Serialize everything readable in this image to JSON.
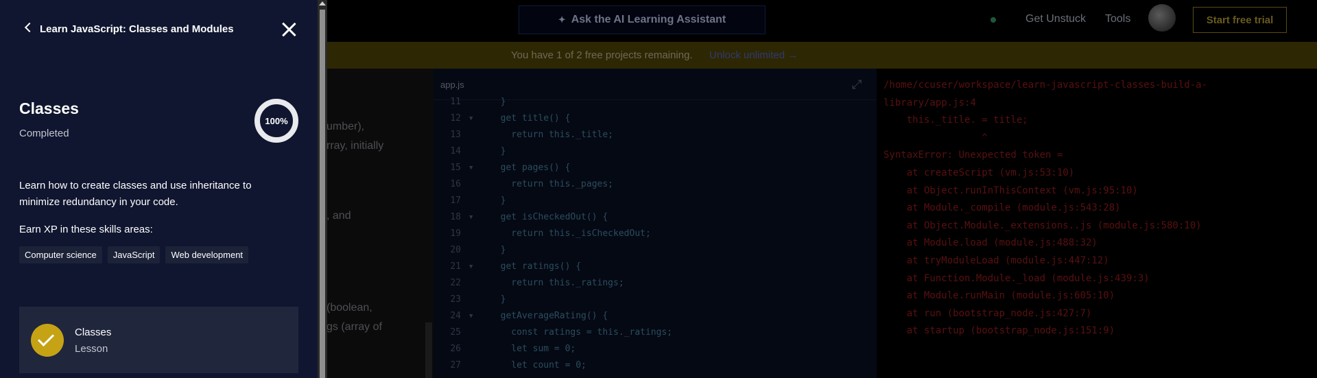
{
  "topbar": {
    "ai_button_label": "Ask the AI Learning Assistant",
    "ai_icon": "sparkle-icon",
    "get_unstuck": "Get Unstuck",
    "tools": "Tools",
    "start_trial": "Start free trial"
  },
  "banner": {
    "text": "You have 1 of 2 free projects remaining.",
    "link": "Unlock unlimited →"
  },
  "instructions": {
    "lines": [
      "umber),",
      "rray, initially",
      ", and",
      "(boolean,",
      "gs (array of"
    ]
  },
  "editor": {
    "file_tab": "app.js",
    "lines": [
      {
        "num": "11",
        "fold": "",
        "code": "  }"
      },
      {
        "num": "12",
        "fold": "▼",
        "code": "  get title() {"
      },
      {
        "num": "13",
        "fold": "",
        "code": "    return this._title;"
      },
      {
        "num": "14",
        "fold": "",
        "code": "  }"
      },
      {
        "num": "15",
        "fold": "▼",
        "code": "  get pages() {"
      },
      {
        "num": "16",
        "fold": "",
        "code": "    return this._pages;"
      },
      {
        "num": "17",
        "fold": "",
        "code": "  }"
      },
      {
        "num": "18",
        "fold": "▼",
        "code": "  get isCheckedOut() {"
      },
      {
        "num": "19",
        "fold": "",
        "code": "    return this._isCheckedOut;"
      },
      {
        "num": "20",
        "fold": "",
        "code": "  }"
      },
      {
        "num": "21",
        "fold": "▼",
        "code": "  get ratings() {"
      },
      {
        "num": "22",
        "fold": "",
        "code": "    return this._ratings;"
      },
      {
        "num": "23",
        "fold": "",
        "code": "  }"
      },
      {
        "num": "24",
        "fold": "▼",
        "code": "  getAverageRating() {"
      },
      {
        "num": "25",
        "fold": "",
        "code": "    const ratings = this._ratings;"
      },
      {
        "num": "26",
        "fold": "",
        "code": "    let sum = 0;"
      },
      {
        "num": "27",
        "fold": "",
        "code": "    let count = 0;"
      }
    ]
  },
  "terminal": {
    "lines": [
      "/home/ccuser/workspace/learn-javascript-classes-build-a-",
      "library/app.js:4",
      "    this._title. = title;",
      "                 ^",
      "SyntaxError: Unexpected token =",
      "    at createScript (vm.js:53:10)",
      "    at Object.runInThisContext (vm.js:95:10)",
      "    at Module._compile (module.js:543:28)",
      "    at Object.Module._extensions..js (module.js:580:10)",
      "    at Module.load (module.js:488:32)",
      "    at tryModuleLoad (module.js:447:12)",
      "    at Function.Module._load (module.js:439:3)",
      "    at Module.runMain (module.js:605:10)",
      "    at run (bootstrap_node.js:427:7)",
      "    at startup (bootstrap_node.js:151:9)"
    ]
  },
  "panel": {
    "course_title": "Learn JavaScript: Classes and Modules",
    "lesson_heading": "Classes",
    "lesson_status": "Completed",
    "progress": "100%",
    "progress_fraction": 1.0,
    "description": "Learn how to create classes and use inheritance to minimize redundancy in your code.",
    "skills_heading": "Earn XP in these skills areas:",
    "skills": [
      "Computer science",
      "JavaScript",
      "Web development"
    ],
    "card": {
      "title": "Classes",
      "subtitle": "Lesson"
    }
  }
}
